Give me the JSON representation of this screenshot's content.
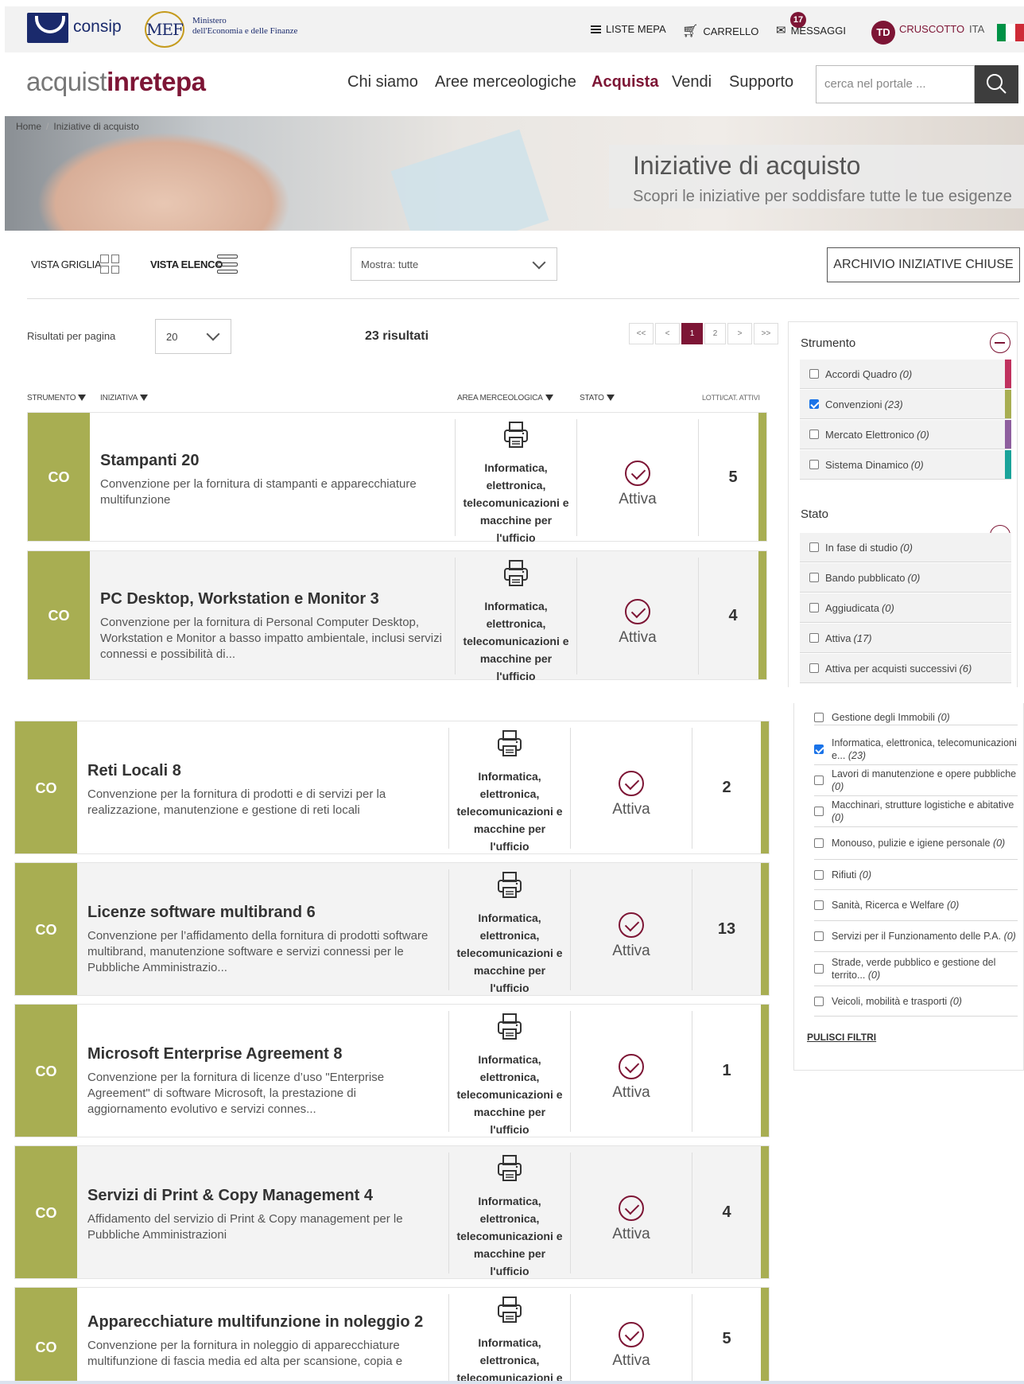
{
  "topbar": {
    "consip": "consip",
    "mef_logo": "MEF",
    "mef_line1": "Ministero",
    "mef_line2": "dell'Economia e delle Finanze",
    "liste_mepa": "LISTE MEPA",
    "carrello": "CARRELLO",
    "messaggi": "MESSAGGI",
    "messaggi_count": "17",
    "avatar": "TD",
    "cruscotto": "CRUSCOTTO",
    "lang": "ITA",
    "flag_colors": [
      "#009246",
      "#ffffff",
      "#ce2b37"
    ]
  },
  "nav": {
    "brand_1": "acquist",
    "brand_2": "inrete",
    "brand_3": "pa",
    "links": [
      "Chi siamo",
      "Aree merceologiche",
      "Acquista",
      "Vendi",
      "Supporto"
    ],
    "active": "Acquista",
    "search_placeholder": "cerca nel portale ..."
  },
  "breadcrumb": [
    "Home",
    "Iniziative di acquisto"
  ],
  "hero": {
    "title": "Iniziative di acquisto",
    "subtitle": "Scopri le iniziative per soddisfare tutte le tue esigenze"
  },
  "toolbar": {
    "vista_griglia": "VISTA GRIGLIA",
    "vista_elenco": "VISTA ELENCO",
    "mostra": "Mostra: tutte",
    "archivio": "ARCHIVIO INIZIATIVE CHIUSE"
  },
  "results": {
    "per_page_label": "Risultati per pagina",
    "per_page_value": "20",
    "count": "23 risultati",
    "pager": [
      "<<",
      "<",
      "1",
      ">",
      ">>"
    ],
    "pager_pages": [
      "1",
      "2"
    ],
    "current_page": "1"
  },
  "columns": {
    "strumento": "STRUMENTO",
    "iniziativa": "INIZIATIVA",
    "area": "AREA MERCEOLOGICA",
    "stato": "STATO",
    "lotti": "LOTTI/CAT. ATTIVI"
  },
  "rows": [
    {
      "code": "CO",
      "title": "Stampanti 20",
      "desc": "Convenzione per la fornitura di stampanti e apparecchiature multifunzione",
      "area": "Informatica, elettronica, telecomunicazioni e macchine per l'ufficio",
      "stato": "Attiva",
      "lotti": "5"
    },
    {
      "code": "CO",
      "title": "PC Desktop, Workstation e Monitor 3",
      "desc": "Convenzione per la fornitura di Personal Computer Desktop, Workstation e Monitor a basso impatto ambientale, inclusi servizi connessi e possibilità di...",
      "area": "Informatica, elettronica, telecomunicazioni e macchine per l'ufficio",
      "stato": "Attiva",
      "lotti": "4"
    },
    {
      "code": "CO",
      "title": "Reti Locali 8",
      "desc": "Convenzione per la fornitura di prodotti e di servizi per la realizzazione, manutenzione e gestione di reti locali",
      "area": "Informatica, elettronica, telecomunicazioni e macchine per l'ufficio",
      "stato": "Attiva",
      "lotti": "2"
    },
    {
      "code": "CO",
      "title": "Licenze software multibrand 6",
      "desc": "Convenzione per l’affidamento della fornitura di prodotti software multibrand, manutenzione software e servizi connessi per le Pubbliche Amministrazio...",
      "area": "Informatica, elettronica, telecomunicazioni e macchine per l'ufficio",
      "stato": "Attiva",
      "lotti": "13"
    },
    {
      "code": "CO",
      "title": "Microsoft Enterprise Agreement 8",
      "desc": "Convenzione per la fornitura di licenze d’uso \"Enterprise Agreement\" di software Microsoft, la prestazione di aggiornamento evolutivo e servizi connes...",
      "area": "Informatica, elettronica, telecomunicazioni e macchine per l'ufficio",
      "stato": "Attiva",
      "lotti": "1"
    },
    {
      "code": "CO",
      "title": "Servizi di Print & Copy Management 4",
      "desc": "Affidamento del servizio di Print & Copy management per le Pubbliche Amministrazioni",
      "area": "Informatica, elettronica, telecomunicazioni e macchine per l'ufficio",
      "stato": "Attiva",
      "lotti": "4"
    },
    {
      "code": "CO",
      "title": "Apparecchiature multifunzione in noleggio 2",
      "desc": "Convenzione per la fornitura in noleggio di apparecchiature multifunzione di fascia media ed alta per scansione, copia e",
      "area": "Informatica, elettronica, telecomunicazioni e",
      "stato": "Attiva",
      "lotti": "5"
    }
  ],
  "filters": {
    "strumento_title": "Strumento",
    "strumento": [
      {
        "label": "Accordi Quadro",
        "count": "(0)",
        "checked": false,
        "color": "#c0325f"
      },
      {
        "label": "Convenzioni",
        "count": "(23)",
        "checked": true,
        "color": "#a8ae52"
      },
      {
        "label": "Mercato Elettronico",
        "count": "(0)",
        "checked": false,
        "color": "#8e5f9e"
      },
      {
        "label": "Sistema Dinamico",
        "count": "(0)",
        "checked": false,
        "color": "#1aa39a"
      }
    ],
    "stato_title": "Stato",
    "stato": [
      {
        "label": "In fase di studio",
        "count": "(0)",
        "checked": false
      },
      {
        "label": "Bando pubblicato",
        "count": "(0)",
        "checked": false
      },
      {
        "label": "Aggiudicata",
        "count": "(0)",
        "checked": false
      },
      {
        "label": "Attiva",
        "count": "(17)",
        "checked": false
      },
      {
        "label": "Attiva per acquisti successivi",
        "count": "(6)",
        "checked": false
      }
    ],
    "area": [
      {
        "label": "Gestione degli Immobili",
        "count": "(0)",
        "checked": false
      },
      {
        "label": "Informatica, elettronica, telecomunicazioni e...",
        "count": "(23)",
        "checked": true
      },
      {
        "label": "Lavori di manutenzione e opere pubbliche",
        "count": "(0)",
        "checked": false
      },
      {
        "label": "Macchinari, strutture logistiche e abitative",
        "count": "(0)",
        "checked": false
      },
      {
        "label": "Monouso, pulizie e igiene personale",
        "count": "(0)",
        "checked": false
      },
      {
        "label": "Rifiuti",
        "count": "(0)",
        "checked": false
      },
      {
        "label": "Sanità, Ricerca e Welfare",
        "count": "(0)",
        "checked": false
      },
      {
        "label": "Servizi per il Funzionamento delle P.A.",
        "count": "(0)",
        "checked": false
      },
      {
        "label": "Strade, verde pubblico e gestione del territo...",
        "count": "(0)",
        "checked": false
      },
      {
        "label": "Veicoli, mobilità e trasporti",
        "count": "(0)",
        "checked": false
      }
    ],
    "pulisci": "PULISCI FILTRI"
  }
}
